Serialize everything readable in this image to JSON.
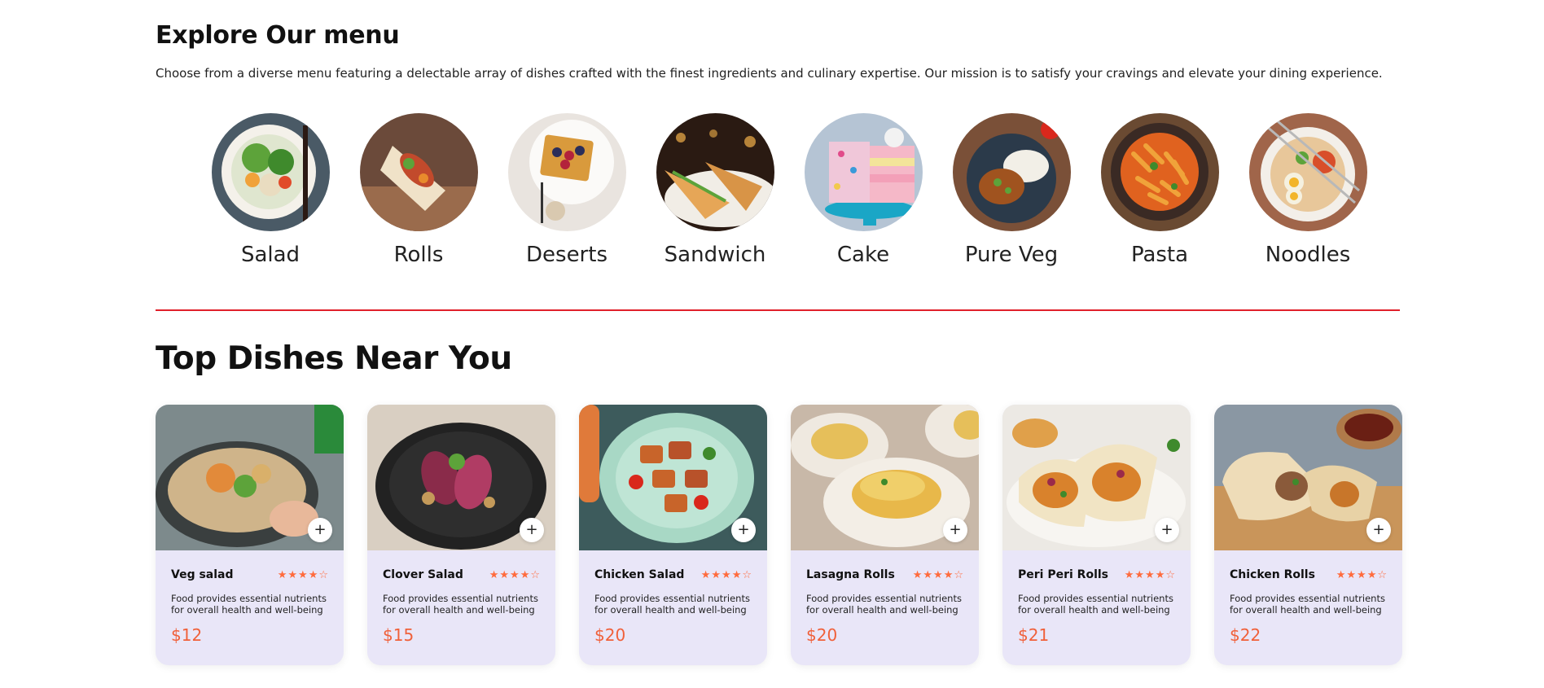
{
  "explore": {
    "title": "Explore Our menu",
    "description": "Choose from a diverse menu featuring a delectable array of dishes crafted with the finest ingredients and culinary expertise. Our mission is to satisfy your cravings and elevate your dining experience."
  },
  "menu": [
    {
      "label": "Salad"
    },
    {
      "label": "Rolls"
    },
    {
      "label": "Deserts"
    },
    {
      "label": "Sandwich"
    },
    {
      "label": "Cake"
    },
    {
      "label": "Pure Veg"
    },
    {
      "label": "Pasta"
    },
    {
      "label": "Noodles"
    }
  ],
  "top_dishes": {
    "title": "Top Dishes Near You",
    "add_icon": "+",
    "rating_stars": 4,
    "rating_max": 5,
    "items": [
      {
        "name": "Veg salad",
        "description": "Food provides essential nutrients for overall health and well-being",
        "price": "$12"
      },
      {
        "name": "Clover Salad",
        "description": "Food provides essential nutrients for overall health and well-being",
        "price": "$15"
      },
      {
        "name": "Chicken Salad",
        "description": "Food provides essential nutrients for overall health and well-being",
        "price": "$20"
      },
      {
        "name": "Lasagna Rolls",
        "description": "Food provides essential nutrients for overall health and well-being",
        "price": "$20"
      },
      {
        "name": "Peri Peri Rolls",
        "description": "Food provides essential nutrients for overall health and well-being",
        "price": "$21"
      },
      {
        "name": "Chicken Rolls",
        "description": "Food provides essential nutrients for overall health and well-being",
        "price": "$22"
      }
    ]
  },
  "colors": {
    "accent": "#e0202a",
    "price": "#f0603a",
    "star": "#ff6b3d",
    "card_bg": "#e9e6f8"
  }
}
